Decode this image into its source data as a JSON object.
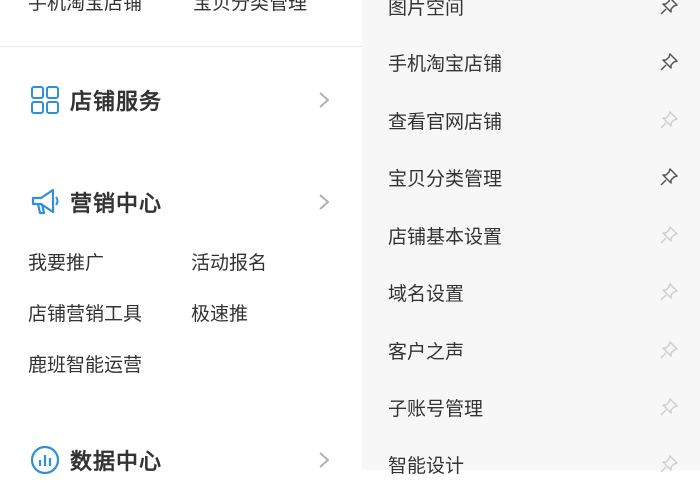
{
  "top_links": [
    "手机淘宝店铺",
    "宝贝分类管理"
  ],
  "sections": [
    {
      "title": "店铺服务",
      "icon": "grid-icon"
    },
    {
      "title": "营销中心",
      "icon": "megaphone-icon",
      "items": [
        "我要推广",
        "活动报名",
        "店铺营销工具",
        "极速推",
        "鹿班智能运营"
      ]
    },
    {
      "title": "数据中心",
      "icon": "chart-icon"
    }
  ],
  "menu": {
    "items": [
      {
        "label": "图片空间",
        "pinned": true
      },
      {
        "label": "手机淘宝店铺",
        "pinned": true
      },
      {
        "label": "查看官网店铺",
        "pinned": false
      },
      {
        "label": "宝贝分类管理",
        "pinned": true
      },
      {
        "label": "店铺基本设置",
        "pinned": false
      },
      {
        "label": "域名设置",
        "pinned": false
      },
      {
        "label": "客户之声",
        "pinned": false
      },
      {
        "label": "子账号管理",
        "pinned": false
      },
      {
        "label": "智能设计",
        "pinned": false
      }
    ]
  },
  "colors": {
    "icon_blue": "#2f8fd8",
    "pin_dark": "#555555",
    "pin_light": "#cfcfcf",
    "chevron": "#b0b0b0"
  }
}
